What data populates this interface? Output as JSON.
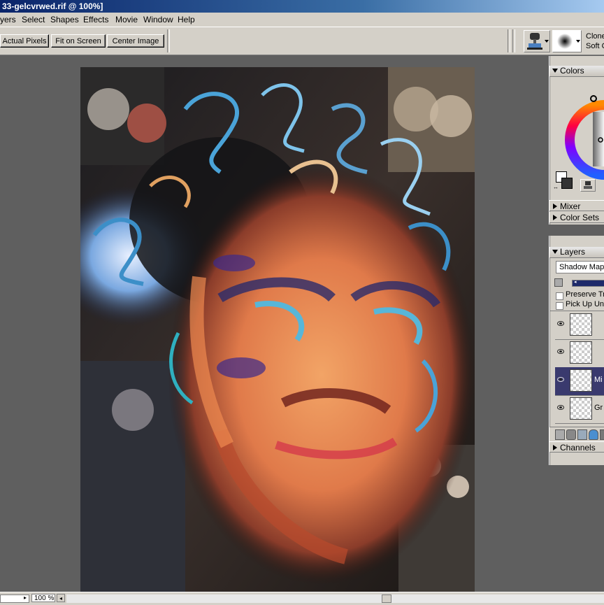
{
  "window": {
    "title": "33-gelcvrwed.rif @ 100%]"
  },
  "menu": [
    "yers",
    "Select",
    "Shapes",
    "Effects",
    "Movie",
    "Window",
    "Help"
  ],
  "toolbar": {
    "actual_pixels": "Actual Pixels",
    "fit_on_screen": "Fit on Screen",
    "center_image": "Center Image",
    "brush_category": "Clone",
    "brush_variant": "Soft C"
  },
  "palettes": {
    "colors": {
      "title": "Colors"
    },
    "mixer": {
      "title": "Mixer"
    },
    "color_sets": {
      "title": "Color Sets"
    },
    "layers": {
      "title": "Layers",
      "composite_method": "Shadow Map",
      "preserve_transparency": "Preserve Tr",
      "pick_up_underlying": "Pick Up Und",
      "items": [
        {
          "label": "",
          "selected": false
        },
        {
          "label": "",
          "selected": false
        },
        {
          "label": "Mi",
          "selected": true
        },
        {
          "label": "Gr",
          "selected": false
        }
      ]
    },
    "channels": {
      "title": "Channels"
    }
  },
  "status": {
    "zoom": "100 %"
  },
  "colors": {
    "chrome": "#d4d0c8",
    "canvas_bg": "#5f5f5f",
    "selected_layer": "#3a3a6e"
  }
}
